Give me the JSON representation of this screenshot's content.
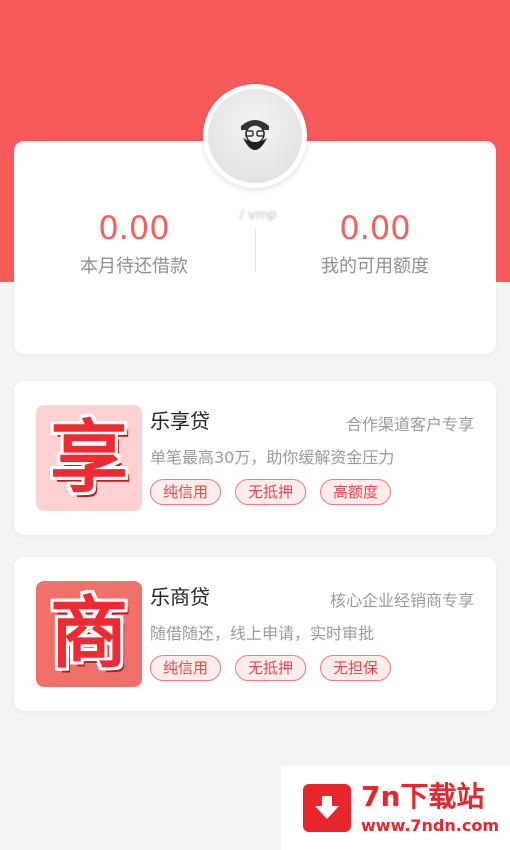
{
  "colors": {
    "header_red": "#f75a5b",
    "accent_red": "#f0615f",
    "chip_red": "#e2494c"
  },
  "profile": {
    "username": "/ vmp",
    "avatar_icon": "user-avatar-icon"
  },
  "summary": {
    "left": {
      "value": "0.00",
      "label": "本月待还借款"
    },
    "right": {
      "value": "0.00",
      "label": "我的可用额度"
    }
  },
  "products": [
    {
      "icon_char": "享",
      "name": "乐享贷",
      "tag": "合作渠道客户专享",
      "desc": "单笔最高30万，助你缓解资金压力",
      "chips": [
        "纯信用",
        "无抵押",
        "高额度"
      ]
    },
    {
      "icon_char": "商",
      "name": "乐商贷",
      "tag": "核心企业经销商专享",
      "desc": "随借随还，线上申请，实时审批",
      "chips": [
        "纯信用",
        "无抵押",
        "无担保"
      ]
    }
  ],
  "watermark": {
    "title": "7n下载站",
    "url": "www.7ndn.com",
    "icon": "download-arrow-icon"
  }
}
